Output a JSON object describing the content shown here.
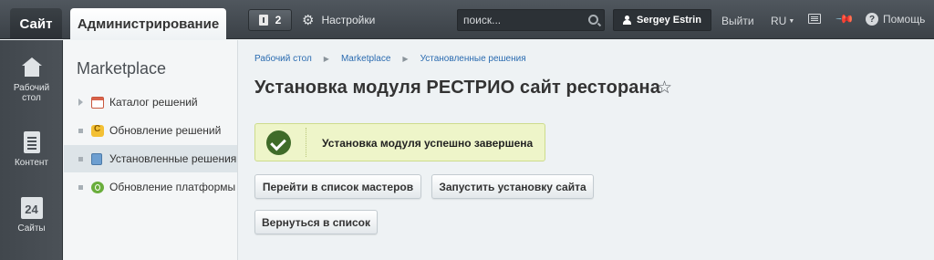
{
  "topbar": {
    "site_tab": "Сайт",
    "admin_tab": "Администрирование",
    "notifications_count": "2",
    "settings_label": "Настройки",
    "search_placeholder": "поиск...",
    "user_name": "Sergey Estrin",
    "logout_label": "Выйти",
    "language": "RU",
    "help_label": "Помощь"
  },
  "leftbar": {
    "items": [
      {
        "label": "Рабочий стол",
        "icon": "home-icon"
      },
      {
        "label": "Контент",
        "icon": "content-icon"
      },
      {
        "label": "Сайты",
        "icon": "sites-icon",
        "icon_text": "24"
      }
    ]
  },
  "submenu": {
    "title": "Marketplace",
    "items": [
      {
        "label": "Каталог решений",
        "icon": "catalog-icon",
        "expander": "arrow"
      },
      {
        "label": "Обновление решений",
        "icon": "update-icon",
        "expander": "bullet"
      },
      {
        "label": "Установленные решения",
        "icon": "installed-icon",
        "expander": "bullet",
        "active": true
      },
      {
        "label": "Обновление платформы",
        "icon": "platform-icon",
        "expander": "bullet"
      }
    ]
  },
  "breadcrumb": [
    "Рабочий стол",
    "Marketplace",
    "Установленные решения"
  ],
  "page": {
    "title": "Установка модуля РЕСТРИО сайт ресторана",
    "success_message": "Установка модуля успешно завершена",
    "buttons": {
      "masters": "Перейти в список мастеров",
      "install": "Запустить установку сайта",
      "back": "Вернуться в список"
    }
  },
  "colors": {
    "topbar": "#454b51",
    "success_bg": "#eef5c9",
    "success_icon": "#3f6b29",
    "link": "#2a6bb0"
  }
}
